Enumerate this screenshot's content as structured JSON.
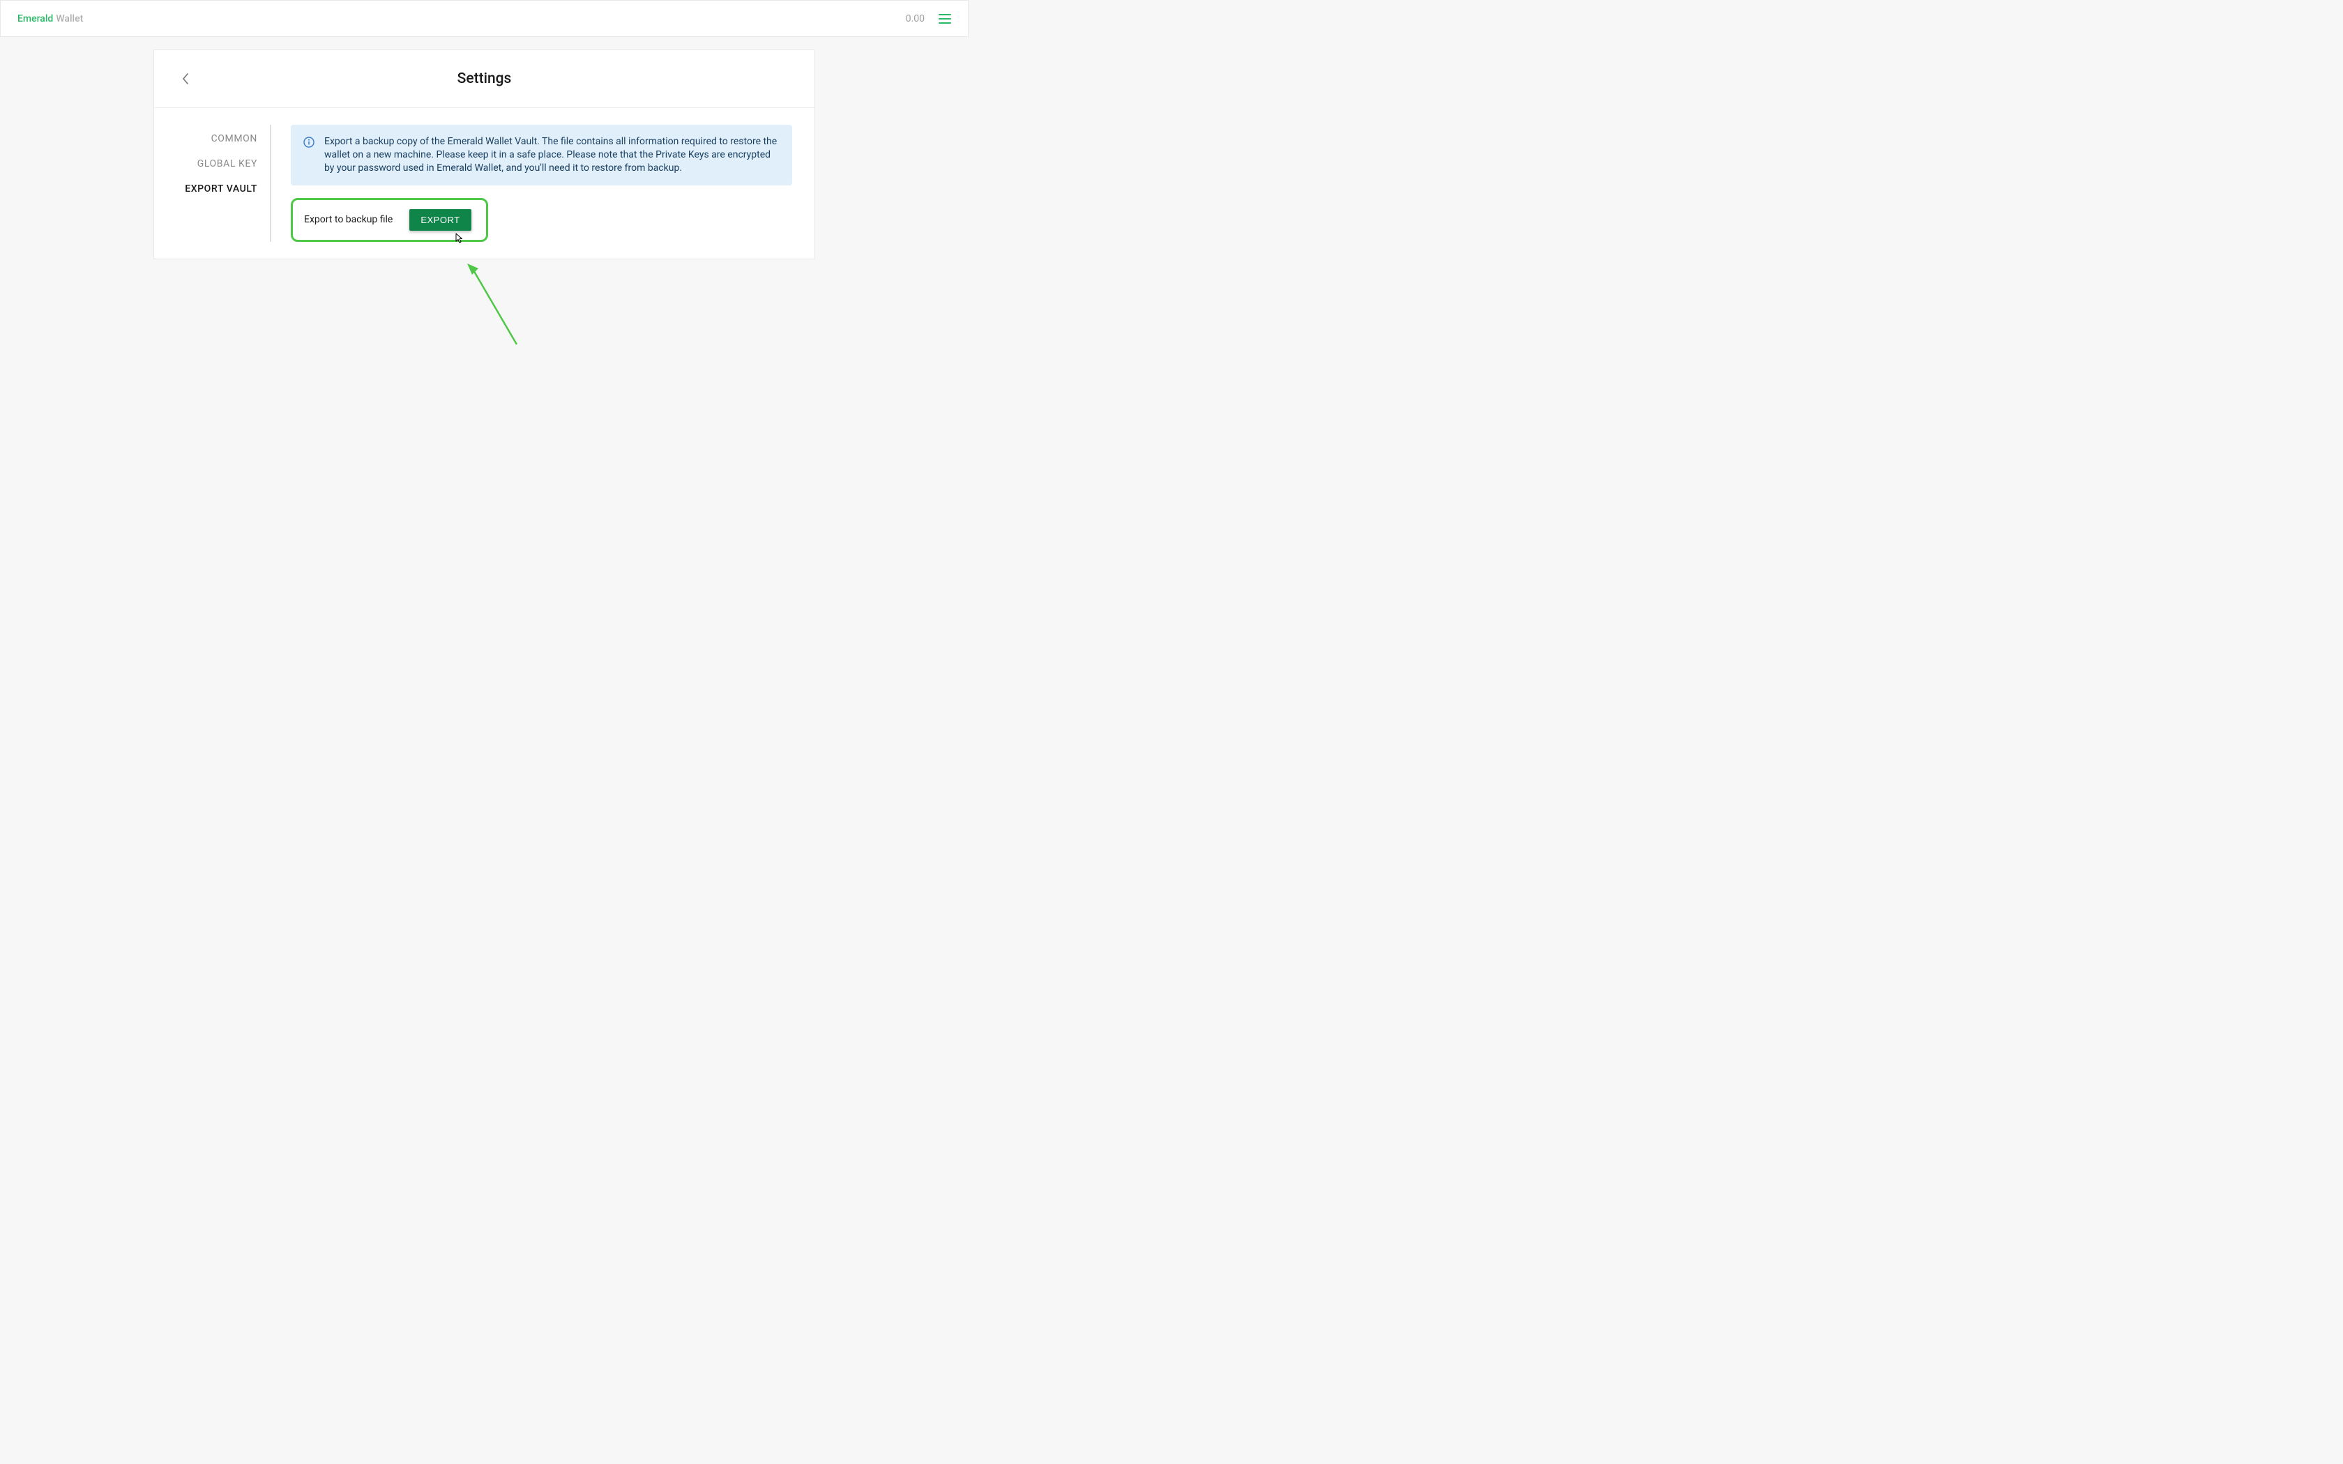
{
  "header": {
    "brand": "Emerald",
    "sub": "Wallet",
    "balance": "0.00"
  },
  "page": {
    "title": "Settings"
  },
  "sidebar": {
    "items": [
      {
        "label": "COMMON",
        "active": false
      },
      {
        "label": "GLOBAL KEY",
        "active": false
      },
      {
        "label": "EXPORT VAULT",
        "active": true
      }
    ]
  },
  "info": {
    "text": "Export a backup copy of the Emerald Wallet Vault. The file contains all information required to restore the wallet on a new machine. Please keep it in a safe place. Please note that the Private Keys are encrypted by your password used in Emerald Wallet, and you'll need it to restore from backup."
  },
  "export": {
    "label": "Export to backup file",
    "button": "EXPORT"
  }
}
